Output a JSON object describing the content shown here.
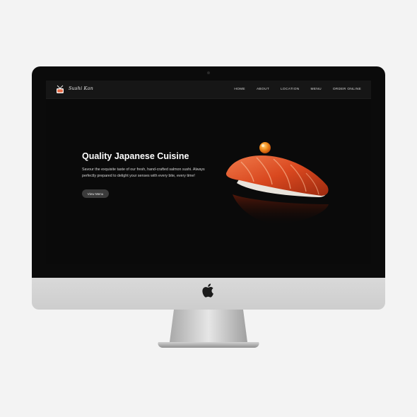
{
  "site": {
    "brand": "Sushi Kan",
    "nav": [
      "HOME",
      "ABOUT",
      "LOCATION",
      "MENU",
      "ORDER ONLINE"
    ]
  },
  "hero": {
    "title": "Quality Japanese Cuisine",
    "description": "Savour the exquisite taste of our fresh, hand-crafted salmon sushi. Always perfectly prepared to delight your senses with every bite, every time!",
    "button_label": "View Menu"
  },
  "icons": {
    "logo": "sushi-logo-icon",
    "device_logo": "apple-logo-icon"
  },
  "colors": {
    "screen_bg": "#0a0a0a",
    "navbar_bg": "#161616",
    "button_bg": "#3b3b3b",
    "salmon": "#e2572a"
  }
}
